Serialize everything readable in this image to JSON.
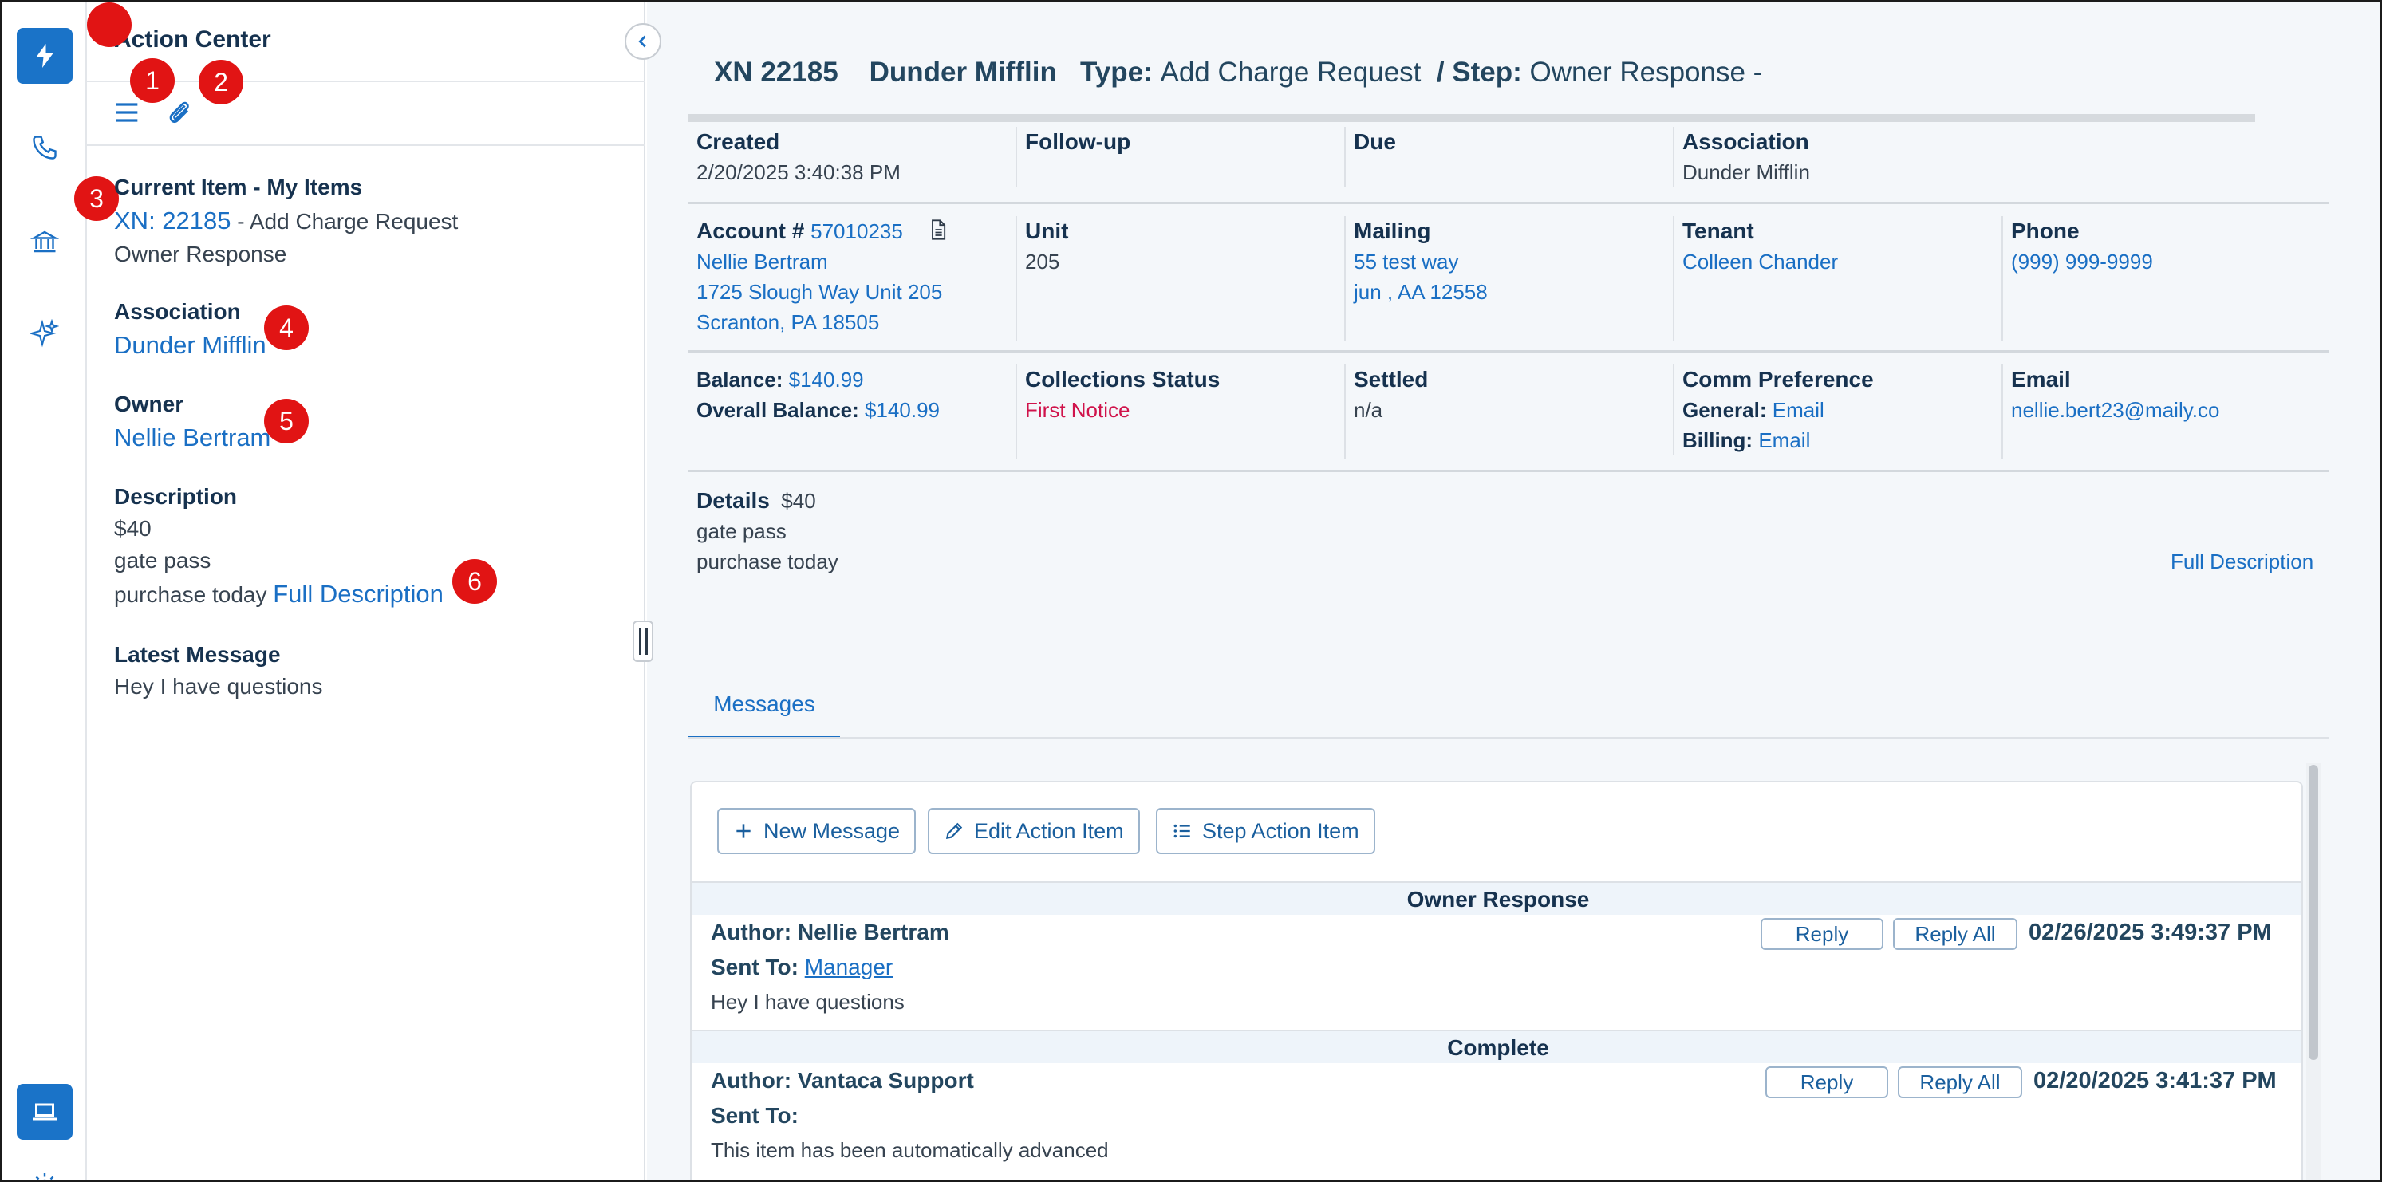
{
  "panel": {
    "title": "Action Center",
    "badges": [
      "1",
      "2",
      "3",
      "4",
      "5",
      "6"
    ],
    "current_item_label": "Current Item - My Items",
    "current_item_link": "XN: 22185",
    "current_item_type": " - Add Charge Request",
    "current_item_step": "Owner Response",
    "association_label": "Association",
    "association_value": "Dunder Mifflin",
    "owner_label": "Owner",
    "owner_value": "Nellie Bertram",
    "description_label": "Description",
    "description_lines": [
      "$40",
      "gate pass",
      "purchase today"
    ],
    "full_description_link": "Full Description",
    "latest_message_label": "Latest Message",
    "latest_message_value": "Hey I have questions"
  },
  "header": {
    "xn": "XN 22185",
    "association": "Dunder Mifflin",
    "type_label": "Type:",
    "type_value": "Add Charge Request",
    "step_label": "/ Step:",
    "step_value": "Owner Response -"
  },
  "row1": {
    "created_label": "Created",
    "created_value": "2/20/2025 3:40:38 PM",
    "followup_label": "Follow-up",
    "due_label": "Due",
    "association_label": "Association",
    "association_value": "Dunder Mifflin"
  },
  "row2": {
    "account_label": "Account #",
    "account_value": "57010235",
    "owner_name": "Nellie Bertram",
    "owner_addr1": "1725 Slough Way Unit 205",
    "owner_addr2": "Scranton, PA 18505",
    "unit_label": "Unit",
    "unit_value": "205",
    "mailing_label": "Mailing",
    "mailing_addr1": "55 test way",
    "mailing_addr2": "jun , AA 12558",
    "tenant_label": "Tenant",
    "tenant_value": "Colleen Chander",
    "phone_label": "Phone",
    "phone_value": "(999) 999-9999"
  },
  "row3": {
    "balance_label": "Balance:",
    "balance_value": "$140.99",
    "overall_label": "Overall Balance:",
    "overall_value": "$140.99",
    "collections_label": "Collections Status",
    "collections_value": "First Notice",
    "settled_label": "Settled",
    "settled_value": "n/a",
    "comm_label": "Comm Preference",
    "general_label": "General:",
    "general_value": "Email",
    "billing_label": "Billing:",
    "billing_value": "Email",
    "email_label": "Email",
    "email_value": "nellie.bert23@maily.co"
  },
  "details": {
    "label": "Details",
    "amount": "$40",
    "lines": [
      "gate pass",
      "purchase today"
    ],
    "full_description_link": "Full Description"
  },
  "tabs": {
    "messages": "Messages"
  },
  "toolbar": {
    "new_message": "New Message",
    "edit_action_item": "Edit Action Item",
    "step_action_item": "Step Action Item"
  },
  "messages": [
    {
      "step": "Owner Response",
      "author": "Author: Nellie Bertram",
      "sent_to_label": "Sent To:",
      "sent_to_value": "Manager",
      "body": "Hey I have questions",
      "reply": "Reply",
      "reply_all": "Reply All",
      "date": "02/26/2025 3:49:37 PM"
    },
    {
      "step": "Complete",
      "author": "Author: Vantaca Support",
      "sent_to_label": "Sent To:",
      "sent_to_value": "",
      "body": "This item has been automatically advanced",
      "reply": "Reply",
      "reply_all": "Reply All",
      "date": "02/20/2025 3:41:37 PM"
    }
  ],
  "colors": {
    "accent": "#1a6fc4",
    "rail_active": "#1a73c8",
    "badge": "#e11414",
    "status_red": "#d0134b"
  },
  "icons": {
    "rail": [
      "lightning-icon",
      "phone-icon",
      "bank-icon",
      "sparkle-icon",
      "laptop-icon",
      "sun-icon"
    ],
    "toolbar": [
      "menu-icon",
      "paperclip-icon",
      "plus-icon",
      "pencil-icon",
      "list-icon",
      "document-icon",
      "chevron-left-icon"
    ]
  }
}
